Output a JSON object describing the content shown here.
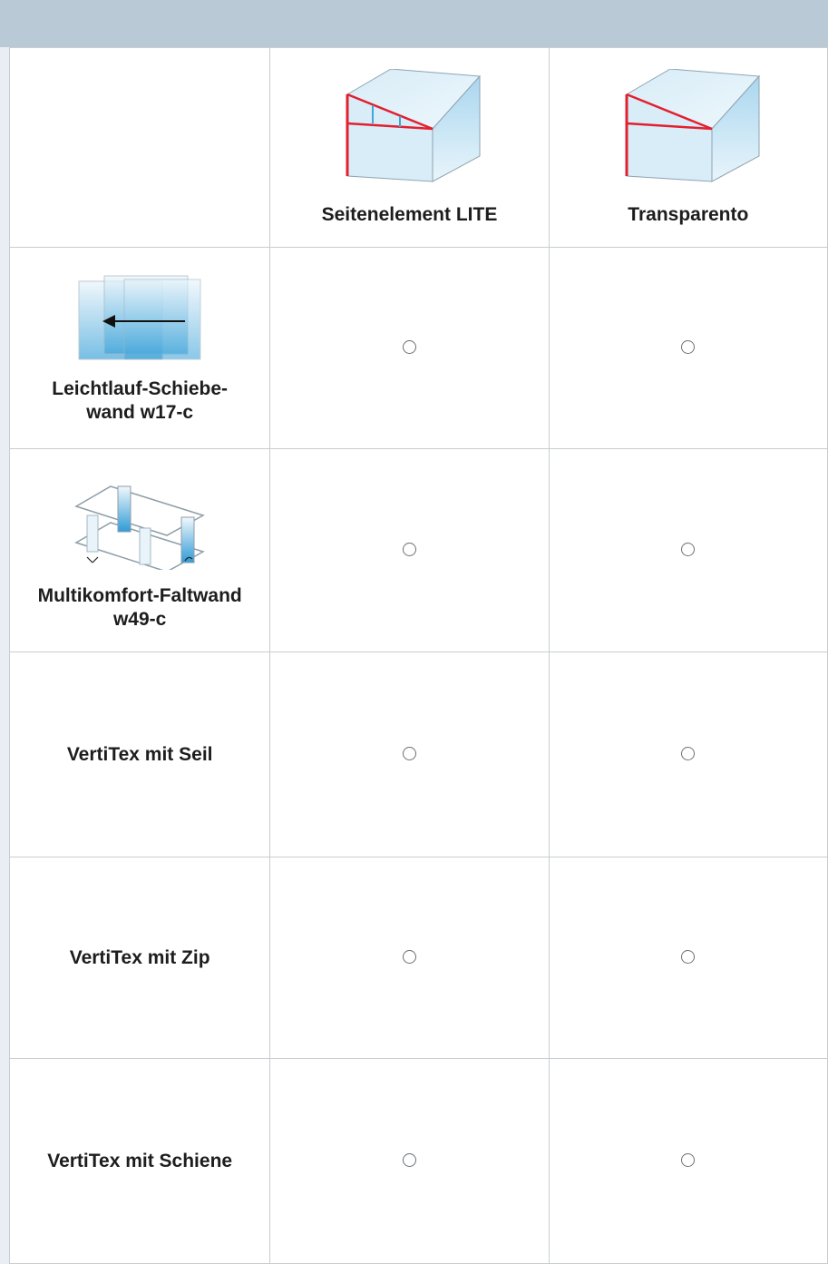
{
  "header": {
    "columns": [
      {
        "label": "Seitenelement LITE",
        "icon": "seitenelement-lite-icon"
      },
      {
        "label": "Transparento",
        "icon": "transparento-icon"
      }
    ]
  },
  "rows": [
    {
      "label_line1": "Leichtlauf-Schiebe-",
      "label_line2": "wand w17-c",
      "icon": "sliding-wall-icon",
      "values": [
        "○",
        "○"
      ]
    },
    {
      "label_line1": "Multikomfort-Faltwand",
      "label_line2": "w49-c",
      "icon": "folding-wall-icon",
      "values": [
        "○",
        "○"
      ]
    },
    {
      "label_line1": "VertiTex mit Seil",
      "label_line2": "",
      "icon": "",
      "values": [
        "○",
        "○"
      ]
    },
    {
      "label_line1": "VertiTex mit Zip",
      "label_line2": "",
      "icon": "",
      "values": [
        "○",
        "○"
      ]
    },
    {
      "label_line1": "VertiTex mit Schiene",
      "label_line2": "",
      "icon": "",
      "values": [
        "○",
        "○"
      ]
    }
  ],
  "colors": {
    "topbar": "#b9cad6",
    "accent_red": "#e2202f",
    "glass_blue": "#7fc4e8"
  }
}
